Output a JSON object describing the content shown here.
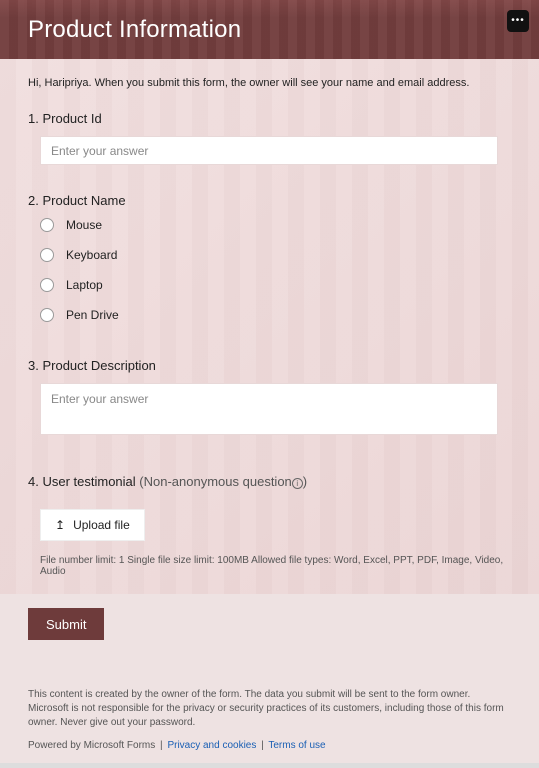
{
  "header": {
    "title": "Product Information"
  },
  "intro": "Hi, Haripriya. When you submit this form, the owner will see your name and email address.",
  "questions": {
    "q1": {
      "num": "1.",
      "label": "Product Id",
      "placeholder": "Enter your answer"
    },
    "q2": {
      "num": "2.",
      "label": "Product Name",
      "options": [
        "Mouse",
        "Keyboard",
        "Laptop",
        "Pen Drive"
      ]
    },
    "q3": {
      "num": "3.",
      "label": "Product Description",
      "placeholder": "Enter your answer"
    },
    "q4": {
      "num": "4.",
      "label": "User testimonial",
      "hint": "(Non-anonymous question",
      "upload_label": "Upload file",
      "file_note": "File number limit: 1    Single file size limit: 100MB    Allowed file types: Word, Excel, PPT, PDF, Image, Video, Audio"
    }
  },
  "submit_label": "Submit",
  "disclaimer": "This content is created by the owner of the form. The data you submit will be sent to the form owner. Microsoft is not responsible for the privacy or security practices of its customers, including those of this form owner. Never give out your password.",
  "powered_prefix": "Powered by Microsoft Forms ",
  "privacy_label": "Privacy and cookies",
  "terms_label": "Terms of use"
}
